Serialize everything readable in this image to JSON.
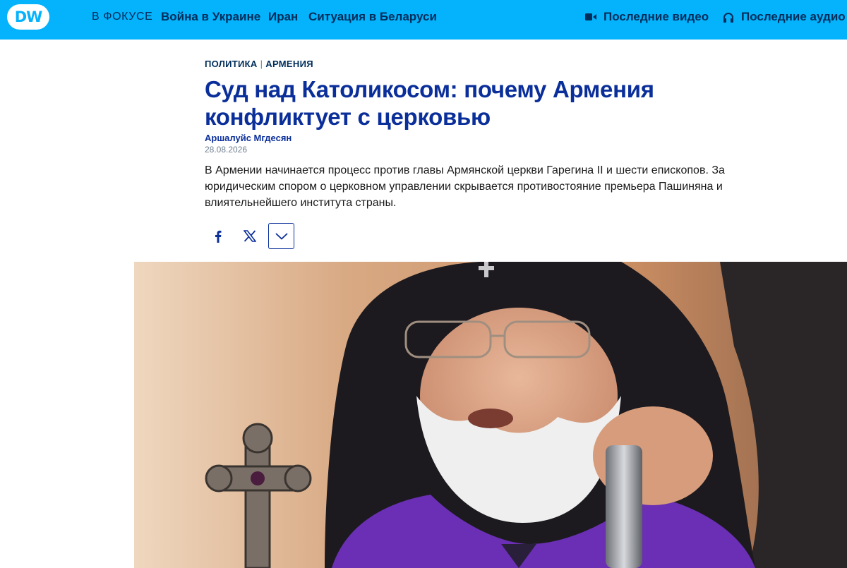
{
  "nav": {
    "logo_text": "DW",
    "focus_label": "В ФОКУСЕ",
    "links": [
      "Война в Украине",
      "Иран",
      "Ситуация в Беларуси"
    ],
    "latest_video": "Последние видео",
    "latest_audio": "Последние аудио"
  },
  "article": {
    "category": "ПОЛИТИКА",
    "tag": "АРМЕНИЯ",
    "title": "Суд над Католикосом: почему Армения конфликтует с церковью",
    "author": "Аршалуйс Мгдесян",
    "date": "28.08.2026",
    "lead": "В Армении начинается процесс против главы Армянской церкви Гарегина II и шести епископов. За юридическим спором о церковном управлении скрывается противостояние премьера Пашиняна и влиятельнейшего института страны."
  },
  "share": {
    "icons": [
      "facebook-icon",
      "x-icon",
      "chevron-down-icon"
    ]
  },
  "colors": {
    "brand_blue": "#05b2fc",
    "title_blue": "#0b2f9a",
    "nav_text": "#002d5a",
    "vestment_purple": "#6a2fb4"
  }
}
